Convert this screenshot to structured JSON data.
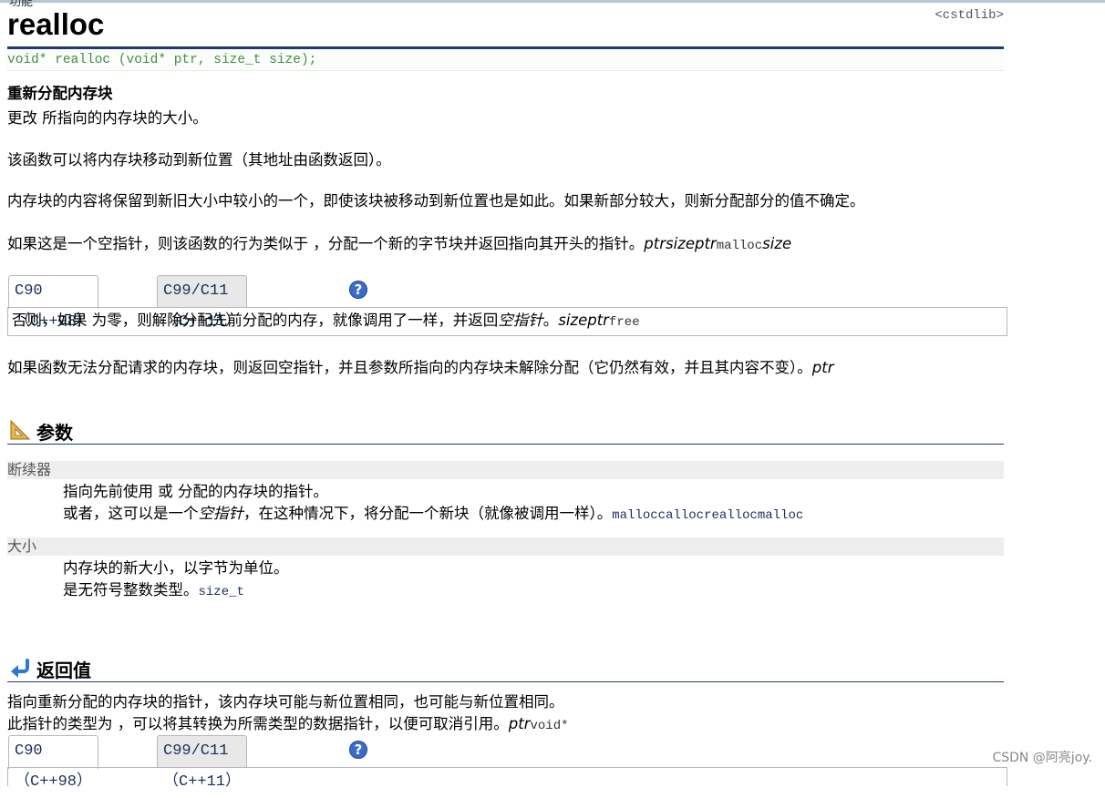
{
  "title": "realloc",
  "header": "<cstdlib>",
  "prototype": "void* realloc (void* ptr, size_t size);",
  "short_desc": "重新分配内存块",
  "para1": "更改 所指向的内存块的大小。",
  "para2": "该函数可以将内存块移动到新位置（其地址由函数返回）。",
  "para3": "内存块的内容将保留到新旧大小中较小的一个，即使该块被移动到新位置也是如此。如果新部分较大，则新分配部分的值不确定。",
  "para4": {
    "text": "如果这是一个空指针，则该函数的行为类似于 ，分配一个新的字节块并返回指向其开头的指针。",
    "it": "ptrsizeptr",
    "code": "malloc",
    "it2": "size"
  },
  "tabs": {
    "c90": "C90 （C++98）",
    "c99": "C99/C11 （C++11）",
    "help": "?"
  },
  "tabbox1": {
    "text1": "否则，如果 为零，则解除分配先前分配的内存，就像调用了一样，并返回",
    "it1": "空指针",
    "text2": "。",
    "it2": "sizeptr",
    "code": "free"
  },
  "para5": {
    "text": "如果函数无法分配请求的内存块，则返回空指针，并且参数所指向的内存块未解除分配（它仍然有效，并且其内容不变）。",
    "it": "ptr"
  },
  "params_title": "参数",
  "param1": {
    "name": "断续器",
    "line1": "指向先前使用 或 分配的内存块的指针。",
    "line2_a": "或者，这可以是一个",
    "line2_it": "空指针",
    "line2_b": "，在这种情况下，将分配一个新块（就像被调用一样）。",
    "line2_code": "malloccallocreallocmalloc"
  },
  "param2": {
    "name": "大小",
    "line1": "内存块的新大小，以字节为单位。",
    "line2": "是无符号整数类型。",
    "line2_code": "size_t"
  },
  "return_title": "返回值",
  "ret1": "指向重新分配的内存块的指针，该内存块可能与新位置相同，也可能与新位置相同。",
  "ret2": {
    "text": "此指针的类型为 ，可以将其转换为所需类型的数据指针，以便可取消引用。",
    "it": "ptr",
    "code": "void*"
  },
  "watermark": "CSDN @阿亮joy.",
  "top_fragment": "功能"
}
